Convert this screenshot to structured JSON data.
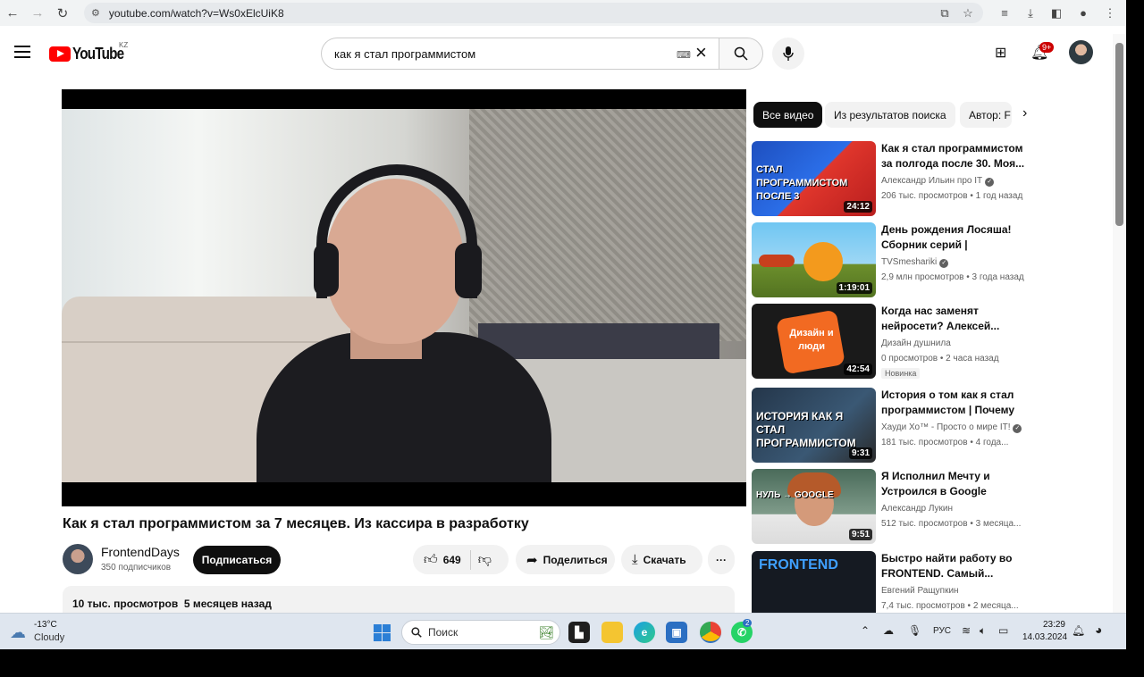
{
  "browser": {
    "url": "youtube.com/watch?v=Ws0xElcUiK8"
  },
  "header": {
    "logo_text": "YouTube",
    "country_code": "KZ",
    "search_value": "как я стал программистом",
    "notifications_count": "9+"
  },
  "video": {
    "title": "Как я стал программистом за 7 месяцев. Из кассира в разработку",
    "channel_name": "FrontendDays",
    "subscribers": "350 подписчиков",
    "subscribe_label": "Подписаться",
    "likes": "649",
    "share_label": "Поделиться",
    "download_label": "Скачать",
    "more_label": "···",
    "description_meta": "10 тыс. просмотров  5 месяцев назад"
  },
  "sidebar": {
    "chips": [
      "Все видео",
      "Из результатов поиска",
      "Автор: F"
    ],
    "items": [
      {
        "title": "Как я стал программистом за полгода после 30. Моя...",
        "channel": "Александр Ильин про IT",
        "verified": true,
        "meta": "206 тыс. просмотров  • 1 год назад",
        "duration": "24:12",
        "thumb_text": "СТАЛ ПРОГРАММИСТОМ ПОСЛЕ 3",
        "badge": ""
      },
      {
        "title": "День рождения Лосяша! Сборник серий | Смешарики...",
        "channel": "TVSmeshariki",
        "verified": true,
        "meta": "2,9 млн просмотров  • 3 года назад",
        "duration": "1:19:01",
        "thumb_text": "",
        "badge": ""
      },
      {
        "title": "Когда нас заменят нейросети? Алексей...",
        "channel": "Дизайн душнила",
        "verified": false,
        "meta": "0 просмотров  • 2 часа назад",
        "duration": "42:54",
        "thumb_text": "Дизайн и люди",
        "badge": "Новинка"
      },
      {
        "title": "История о том как я стал программистом | Почему не...",
        "channel": "Хауди Хо™ - Просто о мире IT!",
        "verified": true,
        "meta": "181 тыс. просмотров  • 4 года...",
        "duration": "9:31",
        "thumb_text": "ИСТОРИЯ КАК Я СТАЛ ПРОГРАММИСТОМ",
        "badge": ""
      },
      {
        "title": "Я Исполнил Мечту и Устроился в Google",
        "channel": "Александр Лукин",
        "verified": false,
        "meta": "512 тыс. просмотров  • 3 месяца...",
        "duration": "9:51",
        "thumb_text": "НУЛЬ → GOOGLE",
        "badge": ""
      },
      {
        "title": "Быстро найти работу во FRONTEND. Самый...",
        "channel": "Евгений Ращупкин",
        "verified": false,
        "meta": "7,4 тыс. просмотров  • 2 месяца...",
        "duration": "",
        "thumb_text": "FRONTEND",
        "badge": ""
      }
    ]
  },
  "taskbar": {
    "temperature": "-13°C",
    "weather": "Cloudy",
    "search_placeholder": "Поиск",
    "language": "РУС",
    "time": "23:29",
    "date": "14.03.2024",
    "chrome_badge": "",
    "whatsapp_badge": "2"
  }
}
